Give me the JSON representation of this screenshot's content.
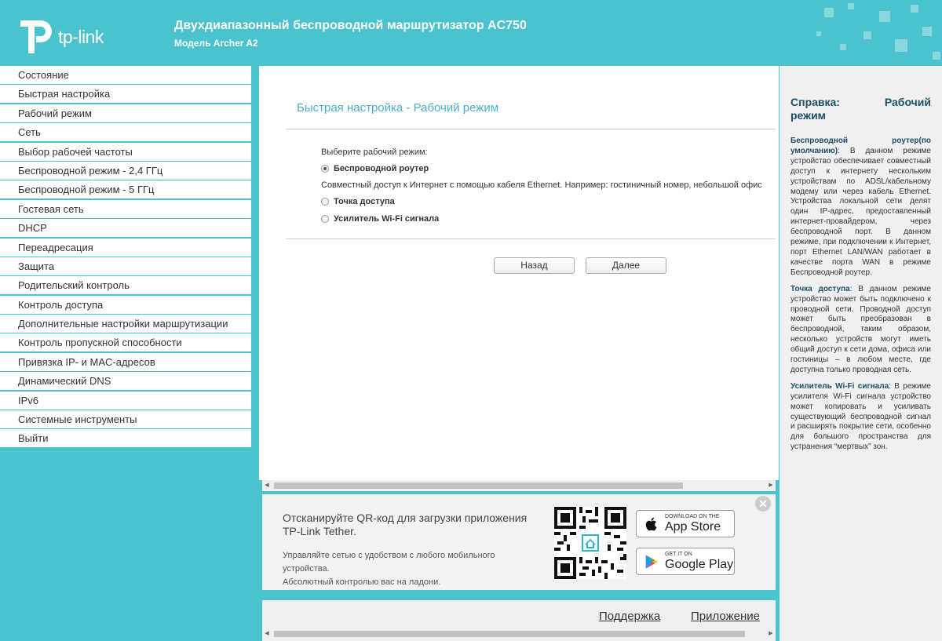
{
  "header": {
    "logo_text": "tp-link",
    "title": "Двухдиапазонный беспроводной маршрутизатор AC750",
    "model": "Модель Archer A2"
  },
  "sidebar": {
    "items": [
      {
        "label": "Состояние"
      },
      {
        "label": "Быстрая настройка"
      },
      {
        "label": "Рабочий режим"
      },
      {
        "label": "Сеть"
      },
      {
        "label": "Выбор рабочей частоты"
      },
      {
        "label": "Беспроводной режим - 2,4 ГГц"
      },
      {
        "label": "Беспроводной режим - 5 ГГц"
      },
      {
        "label": "Гостевая сеть"
      },
      {
        "label": "DHCP"
      },
      {
        "label": "Переадресация"
      },
      {
        "label": "Защита"
      },
      {
        "label": "Родительский контроль"
      },
      {
        "label": "Контроль доступа"
      },
      {
        "label": "Дополнительные настройки маршрутизации"
      },
      {
        "label": "Контроль пропускной способности"
      },
      {
        "label": "Привязка IP- и MAC-адресов"
      },
      {
        "label": "Динамический DNS"
      },
      {
        "label": "IPv6"
      },
      {
        "label": "Системные инструменты"
      },
      {
        "label": "Выйти"
      }
    ]
  },
  "main": {
    "page_title": "Быстрая настройка - Рабочий режим",
    "choose_label": "Выберите рабочий режим:",
    "options": [
      {
        "label": "Беспроводной роутер",
        "selected": true
      },
      {
        "label": "Точка доступа",
        "selected": false
      },
      {
        "label": "Усилитель Wi-Fi сигнала",
        "selected": false
      }
    ],
    "router_description": "Совместный доступ к Интернет с помощью кабеля Ethernet. Например: гостиничный номер, небольшой офис",
    "back_label": "Назад",
    "next_label": "Далее"
  },
  "promo": {
    "title": "Отсканируйте QR-код для загрузки приложения TP-Link Tether.",
    "subtitle_line1": "Управляйте сетью с удобством с любого мобильного устройства.",
    "subtitle_line2": "Абсолютный контролью вас на ладони.",
    "appstore_small": "DOWNLOAD ON THE",
    "appstore_big": "App Store",
    "googleplay_small": "GET IT ON",
    "googleplay_big": "Google Play",
    "close_symbol": "✕"
  },
  "footer": {
    "support_link": "Поддержка",
    "app_link": "Приложение"
  },
  "help": {
    "title_part1": "Справка: Рабочий",
    "title_part2": "режим",
    "router_term": "Беспроводной роутер(по умолчанию)",
    "router_text": ": В данном режиме устройство обеспечивает совместный доступ к интернету нескольким устройствам по ADSL/кабельному модему или через кабель Ethernet. Устройства локальной сети делят один IP-адрес, предоставленный интернет-провайдером, через беспроводной порт. В данном режиме, при подключении к Интернет, порт Ethernet LAN/WAN работает в качестве порта WAN в режиме Беспроводной роутер.",
    "ap_term": "Точка доступа",
    "ap_text": ": В данном режиме устройство может быть подключено к проводной сети. Проводной доступ может быть преобразован в беспроводной, таким образом, несколько устройств могут иметь общий доступ к сети дома, офиса или гостиницы – в любом месте, где доступна только проводная сеть.",
    "ext_term": "Усилитель Wi-Fi сигнала",
    "ext_text": ": В режиме усилителя Wi-Fi сигнала устройство может копировать и усиливать существующий беспроводной сигнал и расширять покрытие сети, особенно для большого пространства для устранения “мертвых” зон."
  },
  "colors": {
    "brand": "#4ac3cf",
    "title_accent": "#4ab2c7",
    "help_heading": "#1d4f66"
  }
}
